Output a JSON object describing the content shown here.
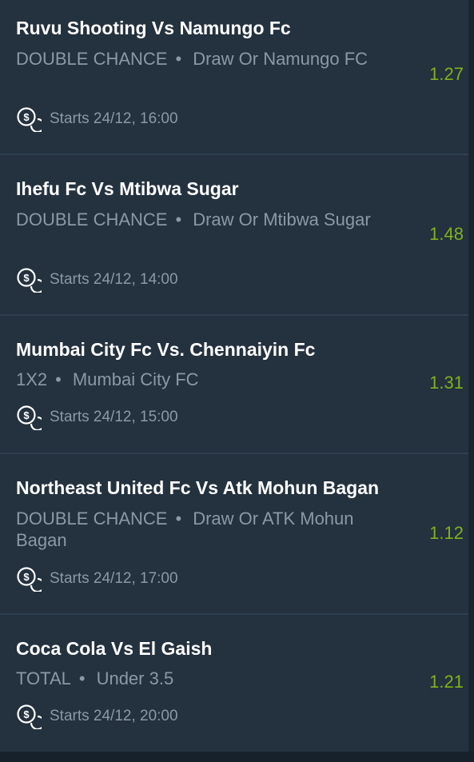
{
  "bets": [
    {
      "match": "Ruvu Shooting Vs Namungo Fc",
      "market": "DOUBLE CHANCE",
      "selection": "Draw Or Namungo FC",
      "odds": "1.27",
      "starts": "Starts 24/12, 16:00",
      "icon": "coins-icon"
    },
    {
      "match": "Ihefu Fc Vs Mtibwa Sugar",
      "market": "DOUBLE CHANCE",
      "selection": "Draw Or Mtibwa Sugar",
      "odds": "1.48",
      "starts": "Starts 24/12, 14:00",
      "icon": "coins-icon"
    },
    {
      "match": "Mumbai City Fc Vs. Chennaiyin Fc",
      "market": "1X2",
      "selection": "Mumbai City FC",
      "odds": "1.31",
      "starts": "Starts 24/12, 15:00",
      "icon": "coins-icon"
    },
    {
      "match": "Northeast United Fc Vs Atk Mohun Bagan",
      "market": "DOUBLE CHANCE",
      "selection": "Draw Or ATK Mohun Bagan",
      "odds": "1.12",
      "starts": "Starts 24/12, 17:00",
      "icon": "coins-icon"
    },
    {
      "match": "Coca Cola Vs El Gaish",
      "market": "TOTAL",
      "selection": "Under 3.5",
      "odds": "1.21",
      "starts": "Starts 24/12, 20:00",
      "icon": "coins-icon"
    }
  ],
  "separator": "•",
  "colors": {
    "background": "#24313e",
    "odds": "#7fb21c",
    "title": "#ffffff",
    "muted": "#8b99a7"
  }
}
